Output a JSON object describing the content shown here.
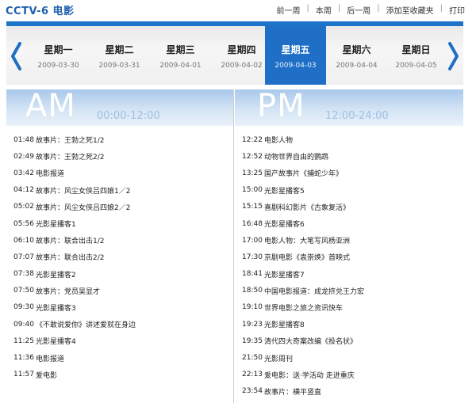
{
  "header": {
    "channel": "CCTV-6  电影",
    "nav": [
      "前一周",
      "本周",
      "后一周",
      "添加至收藏夹",
      "打印"
    ]
  },
  "days": [
    {
      "name": "星期一",
      "date": "2009-03-30"
    },
    {
      "name": "星期二",
      "date": "2009-03-31"
    },
    {
      "name": "星期三",
      "date": "2009-04-01"
    },
    {
      "name": "星期四",
      "date": "2009-04-02"
    },
    {
      "name": "星期五",
      "date": "2009-04-03"
    },
    {
      "name": "星期六",
      "date": "2009-04-04"
    },
    {
      "name": "星期日",
      "date": "2009-04-05"
    }
  ],
  "active_day": "星期五",
  "am": {
    "label": "AM",
    "range": "00:00-12:00",
    "programs": [
      {
        "time": "01:48",
        "title": "故事片：王勃之死1/2"
      },
      {
        "time": "02:49",
        "title": "故事片：王勃之死2/2"
      },
      {
        "time": "03:42",
        "title": "电影报道"
      },
      {
        "time": "04:12",
        "title": "故事片：风尘女侠吕四娘1／2"
      },
      {
        "time": "05:02",
        "title": "故事片：风尘女侠吕四娘2／2"
      },
      {
        "time": "05:56",
        "title": "光影星播客1"
      },
      {
        "time": "06:10",
        "title": "故事片：联合出击1/2"
      },
      {
        "time": "07:07",
        "title": "故事片：联合出击2/2"
      },
      {
        "time": "07:38",
        "title": "光影星播客2"
      },
      {
        "time": "07:50",
        "title": "故事片：党员吴显才"
      },
      {
        "time": "09:30",
        "title": "光影星播客3"
      },
      {
        "time": "09:40",
        "title": "《不敢说爱你》讲述爱就在身边"
      },
      {
        "time": "11:25",
        "title": "光影星播客4"
      },
      {
        "time": "11:36",
        "title": "电影报道"
      },
      {
        "time": "11:57",
        "title": "爱电影"
      }
    ]
  },
  "pm": {
    "label": "PM",
    "range": "12:00-24:00",
    "programs": [
      {
        "time": "12:22",
        "title": "电影人物"
      },
      {
        "time": "12:52",
        "title": "动物世界自由的鹦鹉"
      },
      {
        "time": "13:25",
        "title": "国产故事片《捕蛇少年》"
      },
      {
        "time": "15:00",
        "title": "光影星播客5"
      },
      {
        "time": "15:15",
        "title": "喜剧科幻影片《古象复活》"
      },
      {
        "time": "16:48",
        "title": "光影星播客6"
      },
      {
        "time": "17:00",
        "title": "电影人物：大笔写风杨亚洲"
      },
      {
        "time": "17:30",
        "title": "京剧电影《袁崇焕》首映式"
      },
      {
        "time": "18:41",
        "title": "光影星播客7"
      },
      {
        "time": "18:50",
        "title": "中国电影报道：成龙挤兑王力宏"
      },
      {
        "time": "19:10",
        "title": "世界电影之旅之资讯快车"
      },
      {
        "time": "19:23",
        "title": "光影星播客8"
      },
      {
        "time": "19:35",
        "title": "清代四大奇案改编《投名状》"
      },
      {
        "time": "21:50",
        "title": "光影周刊"
      },
      {
        "time": "22:13",
        "title": "爱电影：送·学活动 走进重庆"
      },
      {
        "time": "23:54",
        "title": "故事片：横平竖直"
      }
    ]
  },
  "colors": {
    "accent": "#1f6fc7",
    "channel": "#1f5fae",
    "panel_head": "#a9c8ea"
  }
}
